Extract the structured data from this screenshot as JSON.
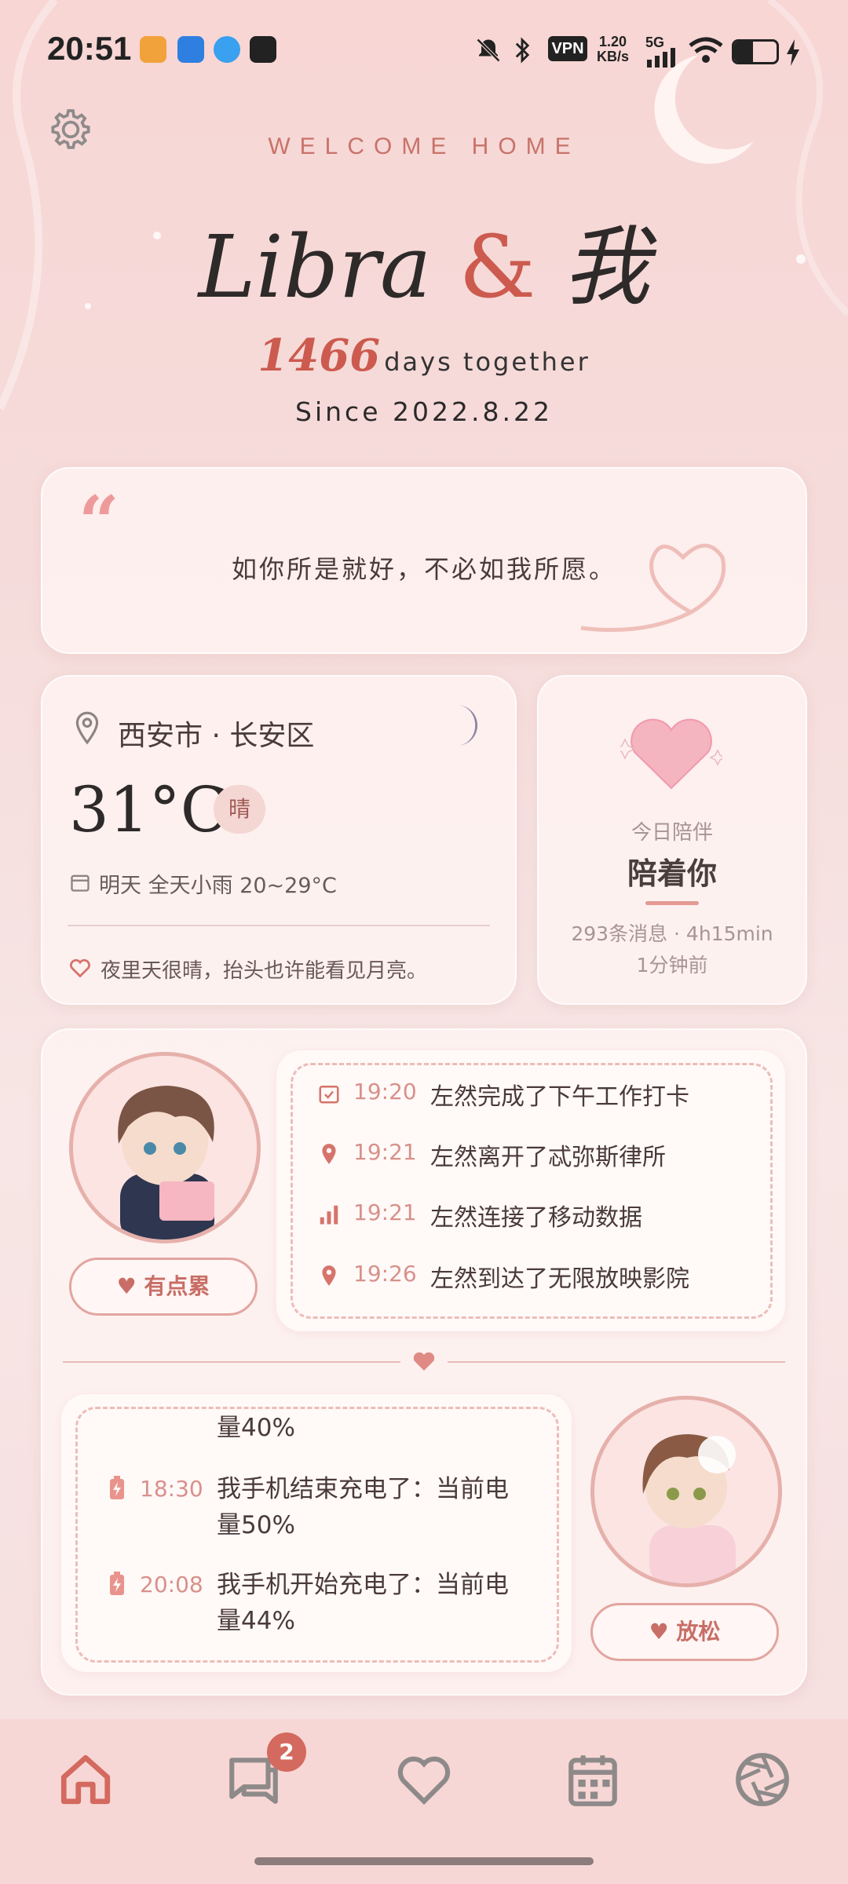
{
  "status_bar": {
    "time": "20:51",
    "vpn": "VPN",
    "net_speed_value": "1.20",
    "net_speed_unit": "KB/s",
    "network": "5G"
  },
  "header": {
    "welcome": "WELCOME HOME",
    "title_name": "Libra",
    "title_amp": "&",
    "title_me": "我",
    "days_count": "1466",
    "days_label": "days together",
    "since": "Since 2022.8.22"
  },
  "quote": {
    "mark": "“",
    "text": "如你所是就好，不必如我所愿。"
  },
  "weather": {
    "location": "西安市 · 长安区",
    "temperature": "31°C",
    "condition": "晴",
    "forecast": "明天  全天小雨  20~29°C",
    "hint": "夜里天很晴，抬头也许能看见月亮。"
  },
  "companion": {
    "label": "今日陪伴",
    "title": "陪着你",
    "stats": "293条消息 · 4h15min",
    "ago": "1分钟前"
  },
  "partner": {
    "mood": "有点累",
    "activities": [
      {
        "icon": "calendar-check-icon",
        "time": "19:20",
        "desc": "左然完成了下午工作打卡"
      },
      {
        "icon": "location-pin-icon",
        "time": "19:21",
        "desc": "左然离开了忒弥斯律所"
      },
      {
        "icon": "signal-bars-icon",
        "time": "19:21",
        "desc": "左然连接了移动数据"
      },
      {
        "icon": "location-pin-icon",
        "time": "19:26",
        "desc": "左然到达了无限放映影院"
      }
    ]
  },
  "me": {
    "mood": "放松",
    "phone_log": [
      {
        "time": "",
        "desc": "量40%"
      },
      {
        "icon": "battery-charging-icon",
        "time": "18:30",
        "desc": "我手机结束充电了：当前电量50%"
      },
      {
        "icon": "battery-charging-icon",
        "time": "20:08",
        "desc": "我手机开始充电了：当前电量44%"
      }
    ]
  },
  "nav": {
    "items": [
      "home-icon",
      "chat-icon",
      "heart-icon",
      "calendar-icon",
      "camera-shutter-icon"
    ],
    "chat_badge": "2"
  },
  "colors": {
    "accent": "#cc5a4e",
    "soft_pink": "#e6b0ab",
    "background": "#f7d6d4"
  }
}
